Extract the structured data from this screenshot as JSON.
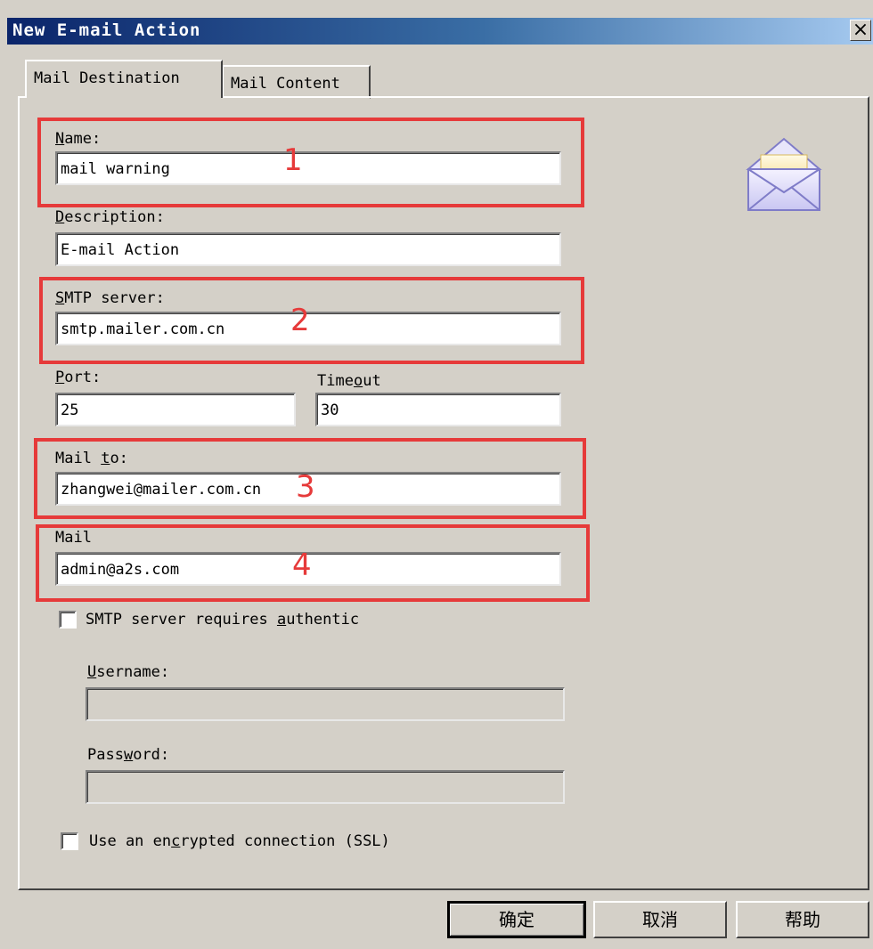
{
  "window": {
    "title": "New E-mail Action",
    "close_label": "×"
  },
  "tabs": [
    {
      "label": "Mail Destination",
      "active": true
    },
    {
      "label": "Mail Content",
      "active": false
    }
  ],
  "form": {
    "name": {
      "label_key": "N",
      "label_rest": "ame:",
      "value": "mail warning"
    },
    "description": {
      "label_key": "D",
      "label_rest": "escription:",
      "value": "E-mail Action"
    },
    "smtp": {
      "label_key": "S",
      "label_rest": "MTP server:",
      "value": "smtp.mailer.com.cn"
    },
    "port": {
      "label_key": "P",
      "label_rest": "ort:",
      "value": "25"
    },
    "timeout": {
      "label_pre": "Time",
      "label_key": "o",
      "label_rest": "ut",
      "value": "30"
    },
    "mail_to": {
      "label_pre": "Mail ",
      "label_key": "t",
      "label_rest": "o:",
      "value": "zhangwei@mailer.com.cn"
    },
    "mail_from": {
      "label": "Mail",
      "value": "admin@a2s.com"
    },
    "auth": {
      "label_pre": "SMTP server requires ",
      "label_key": "a",
      "label_rest": "uthentic",
      "checked": false
    },
    "username": {
      "label_key": "U",
      "label_rest": "sername:",
      "value": ""
    },
    "password": {
      "label_pre": "Pass",
      "label_key": "w",
      "label_rest": "ord:",
      "value": ""
    },
    "ssl": {
      "label_pre": "Use an en",
      "label_key": "c",
      "label_rest": "rypted connection (SSL)",
      "checked": false
    }
  },
  "annotations": {
    "box1": "1",
    "box2": "2",
    "box3": "3",
    "box4": "4",
    "color": "#e63a3a"
  },
  "buttons": {
    "ok": "确定",
    "cancel": "取消",
    "help": "帮助"
  },
  "icons": {
    "envelope": "envelope-icon"
  }
}
